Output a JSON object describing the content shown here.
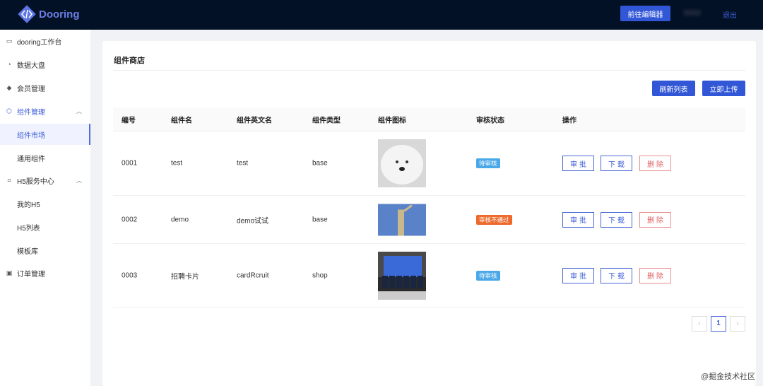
{
  "header": {
    "logo_text": "Dooring",
    "editor_button": "前往编辑器",
    "logout": "退出"
  },
  "sidebar": {
    "items": [
      {
        "label": "dooring工作台",
        "icon": "monitor-icon"
      },
      {
        "label": "数据大盘",
        "icon": "pie-chart-icon"
      },
      {
        "label": "会员管理",
        "icon": "diamond-icon"
      },
      {
        "label": "组件管理",
        "icon": "cube-icon",
        "expanded": true
      },
      {
        "label": "组件市场",
        "selected": true
      },
      {
        "label": "通用组件"
      },
      {
        "label": "H5服务中心",
        "icon": "scan-icon",
        "expanded": true
      },
      {
        "label": "我的H5"
      },
      {
        "label": "H5列表"
      },
      {
        "label": "模板库"
      },
      {
        "label": "订单管理",
        "icon": "calendar-icon"
      }
    ]
  },
  "main": {
    "title": "组件商店",
    "refresh_button": "刷新列表",
    "upload_button": "立即上传",
    "columns": [
      "编号",
      "组件名",
      "组件英文名",
      "组件类型",
      "组件图标",
      "审核状态",
      "操作"
    ],
    "rows": [
      {
        "id": "0001",
        "name": "test",
        "en_name": "test",
        "type": "base",
        "image": "samoyed-dog-photo",
        "status": "待审核",
        "status_color": "#4aa8e8"
      },
      {
        "id": "0002",
        "name": "demo",
        "en_name": "demo试试",
        "type": "base",
        "image": "monument-pillar-photo",
        "status": "审核不通过",
        "status_color": "#ee6a2c"
      },
      {
        "id": "0003",
        "name": "招聘卡片",
        "en_name": "cardRcruit",
        "type": "shop",
        "image": "group-presentation-photo",
        "status": "待审核",
        "status_color": "#4aa8e8"
      }
    ],
    "actions": {
      "approve": "审批",
      "download": "下载",
      "delete": "删除"
    },
    "pagination": {
      "current": "1"
    }
  },
  "watermark": "@掘金技术社区",
  "colors": {
    "primary": "#3257d6",
    "header_bg": "#031127",
    "danger": "#e06060"
  }
}
